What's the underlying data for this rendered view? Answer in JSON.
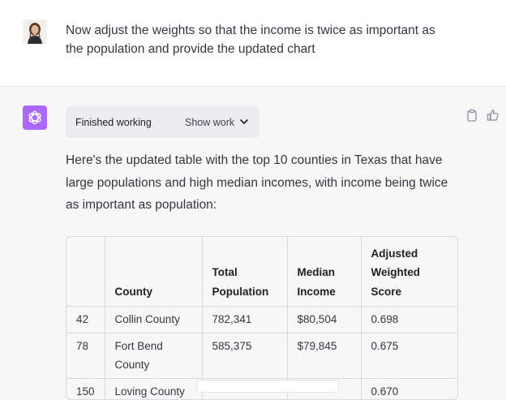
{
  "user_message": {
    "line1": "Now adjust the weights so that the income is twice as important as",
    "line2": "the population and provide the updated chart"
  },
  "status": {
    "label": "Finished working",
    "show_work": "Show work"
  },
  "answer": {
    "line1": "Here's the updated table with the top 10 counties in Texas that have",
    "line2": "large populations and high median incomes, with income being twice",
    "line3": "as important as population:"
  },
  "table": {
    "headers": {
      "county": "County",
      "pop_1": "Total",
      "pop_2": "Population",
      "inc_1": "Median",
      "inc_2": "Income",
      "score_1": "Adjusted",
      "score_2": "Weighted",
      "score_3": "Score"
    },
    "rows": [
      {
        "rank": "42",
        "county": "Collin County",
        "population": "782,341",
        "income": "$80,504",
        "score": "0.698"
      },
      {
        "rank": "78",
        "county_1": "Fort Bend",
        "county_2": "County",
        "population": "585,375",
        "income": "$79,845",
        "score": "0.675"
      },
      {
        "rank": "150",
        "county": "Loving County",
        "population": "",
        "income": "",
        "score": "0.670"
      }
    ]
  },
  "colors": {
    "assistant_avatar": "#ab68ff",
    "user_block_bg": "#ffffff",
    "page_bg": "#f7f7f8"
  },
  "icons": {
    "copy": "clipboard-icon",
    "like": "thumbs-up-icon",
    "chevron": "chevron-down-icon",
    "logo": "openai-logo-icon"
  }
}
